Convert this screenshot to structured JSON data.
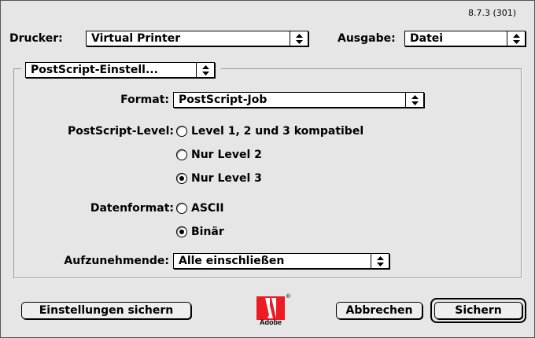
{
  "version": "8.7.3 (301)",
  "header": {
    "printer_label": "Drucker:",
    "printer_value": "Virtual Printer",
    "output_label": "Ausgabe:",
    "output_value": "Datei"
  },
  "panel_popup_value": "PostScript-Einstell...",
  "format": {
    "label": "Format:",
    "value": "PostScript-Job"
  },
  "postscript_level": {
    "label": "PostScript-Level:",
    "options": [
      {
        "label": "Level 1, 2 und 3 kompatibel",
        "selected": false
      },
      {
        "label": "Nur Level 2",
        "selected": false
      },
      {
        "label": "Nur Level 3",
        "selected": true
      }
    ]
  },
  "data_format": {
    "label": "Datenformat:",
    "options": [
      {
        "label": "ASCII",
        "selected": false
      },
      {
        "label": "Binär",
        "selected": true
      }
    ]
  },
  "fonts": {
    "label": "Aufzunehmende:",
    "value": "Alle einschließen"
  },
  "buttons": {
    "save_settings": "Einstellungen sichern",
    "cancel": "Abbrechen",
    "save": "Sichern"
  },
  "logo": {
    "text": "Adobe",
    "brand_color": "#ed1c24"
  },
  "colors": {
    "dialog_bg": "#e6e6e6"
  }
}
